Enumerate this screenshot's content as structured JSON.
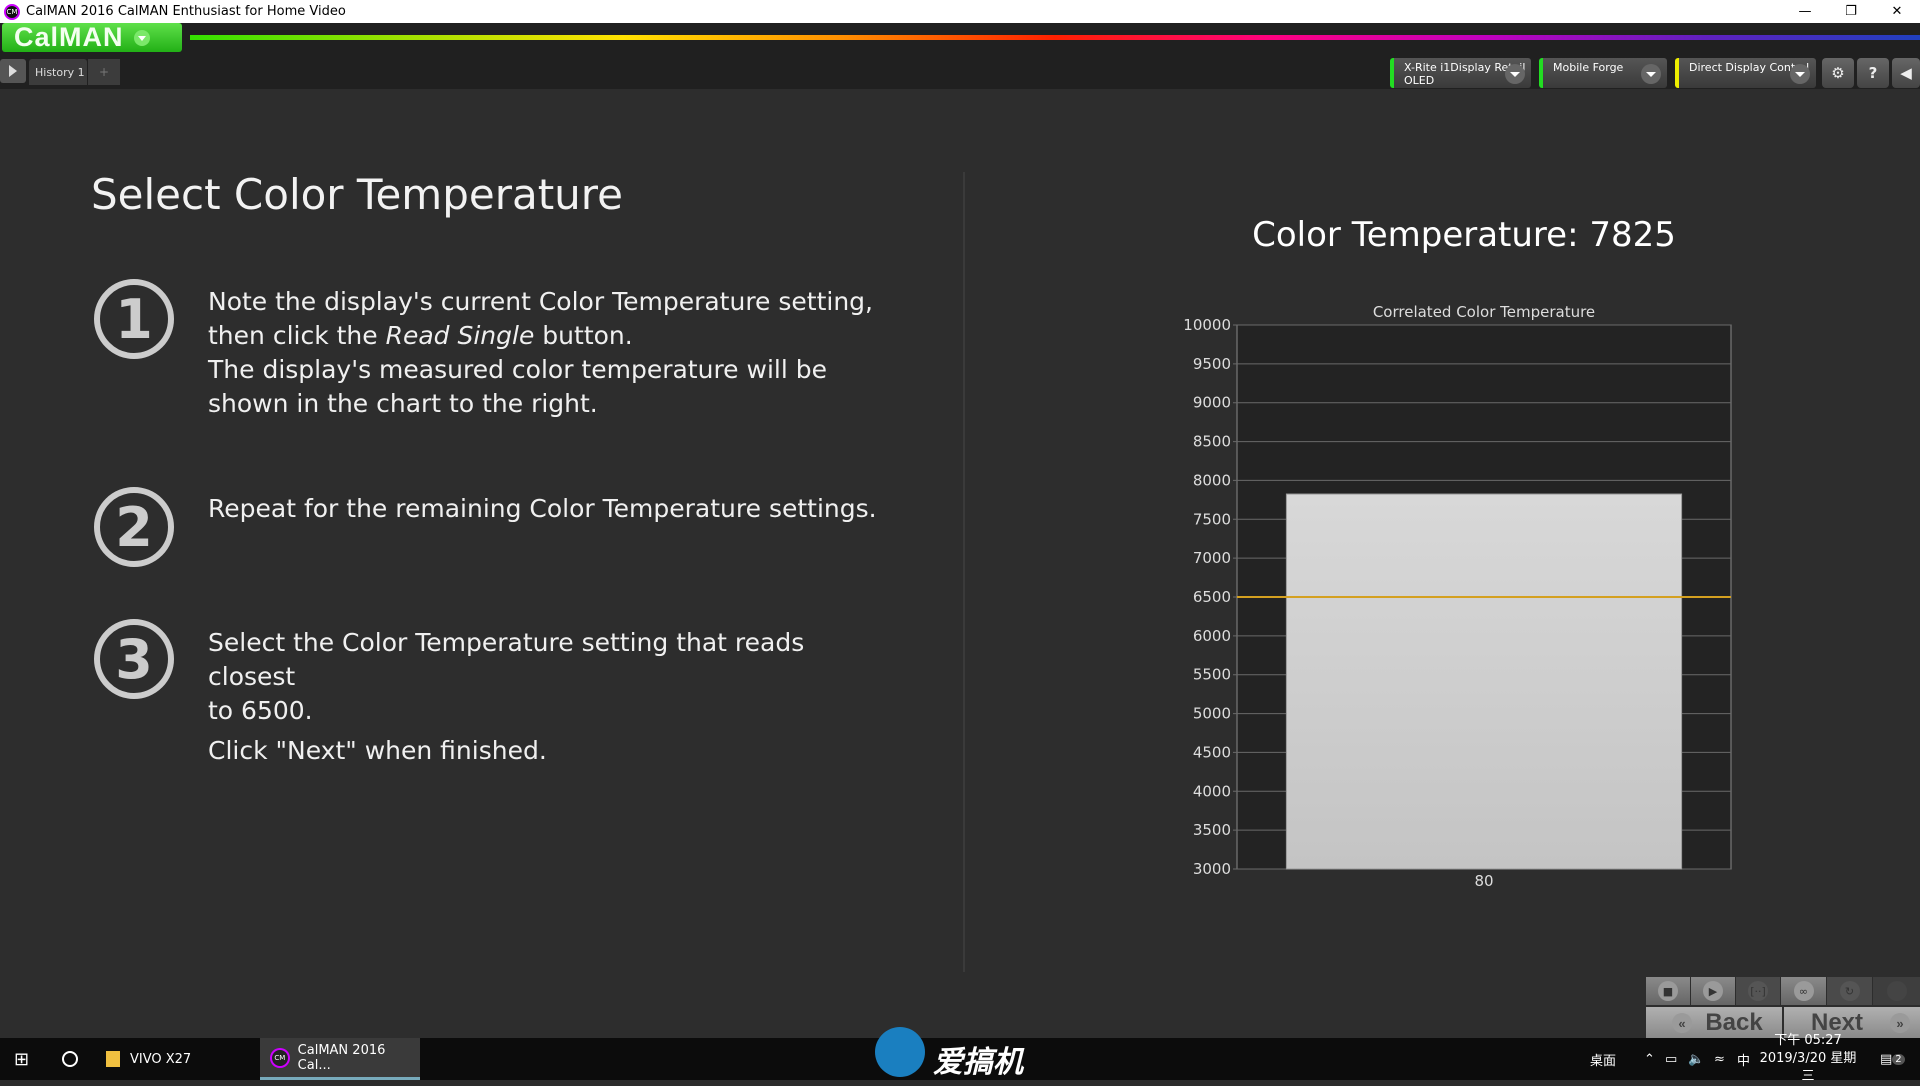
{
  "window": {
    "title": "CalMAN 2016 CalMAN Enthusiast for Home Video",
    "icon_text": "CM"
  },
  "app": {
    "logo": "CalMAN"
  },
  "tabs": [
    {
      "label": "History 1"
    }
  ],
  "add_tab": "+",
  "devices": [
    {
      "line1": "X-Rite i1Display Retail",
      "line2": "OLED",
      "color": "#22dd22"
    },
    {
      "line1": "Mobile Forge",
      "line2": "",
      "color": "#22dd22"
    },
    {
      "line1": "Direct Display Control",
      "line2": "",
      "color": "#eeee00"
    }
  ],
  "page": {
    "title": "Select Color Temperature",
    "steps": [
      {
        "num": "1",
        "lines": [
          "Note the display's current Color Temperature setting,",
          "then click the "
        ],
        "italic": "Read Single",
        "after": " button.",
        "more": [
          "The display's measured color temperature will be",
          "shown in the chart to the right."
        ]
      },
      {
        "num": "2",
        "lines": [
          "Repeat for the remaining Color Temperature settings."
        ]
      },
      {
        "num": "3",
        "lines": [
          "Select the Color Temperature setting that reads closest",
          "to 6500."
        ],
        "more": [
          "Click \"Next\" when finished."
        ]
      }
    ],
    "ct_label": "Color Temperature: 7825"
  },
  "chart_data": {
    "type": "bar",
    "title": "Correlated Color Temperature",
    "categories": [
      "80"
    ],
    "values": [
      7825
    ],
    "ylim": [
      3000,
      10000
    ],
    "yticks": [
      3000,
      3500,
      4000,
      4500,
      5000,
      5500,
      6000,
      6500,
      7000,
      7500,
      8000,
      8500,
      9000,
      9500,
      10000
    ],
    "reference_line": 6500,
    "grid": true,
    "colors": {
      "bar": "#c4c4c4",
      "reference": "#d4a020",
      "plot_bg": "#232323"
    }
  },
  "nav": {
    "back": "Back",
    "next": "Next"
  },
  "taskbar": {
    "items": [
      {
        "label": "VIVO X27"
      },
      {
        "label": "CalMAN 2016 Cal..."
      }
    ],
    "watermark": "爱搞机",
    "desktop": "桌面",
    "ime": "中",
    "time": "下午 05:27",
    "date": "2019/3/20 星期三",
    "notifications": "2"
  }
}
